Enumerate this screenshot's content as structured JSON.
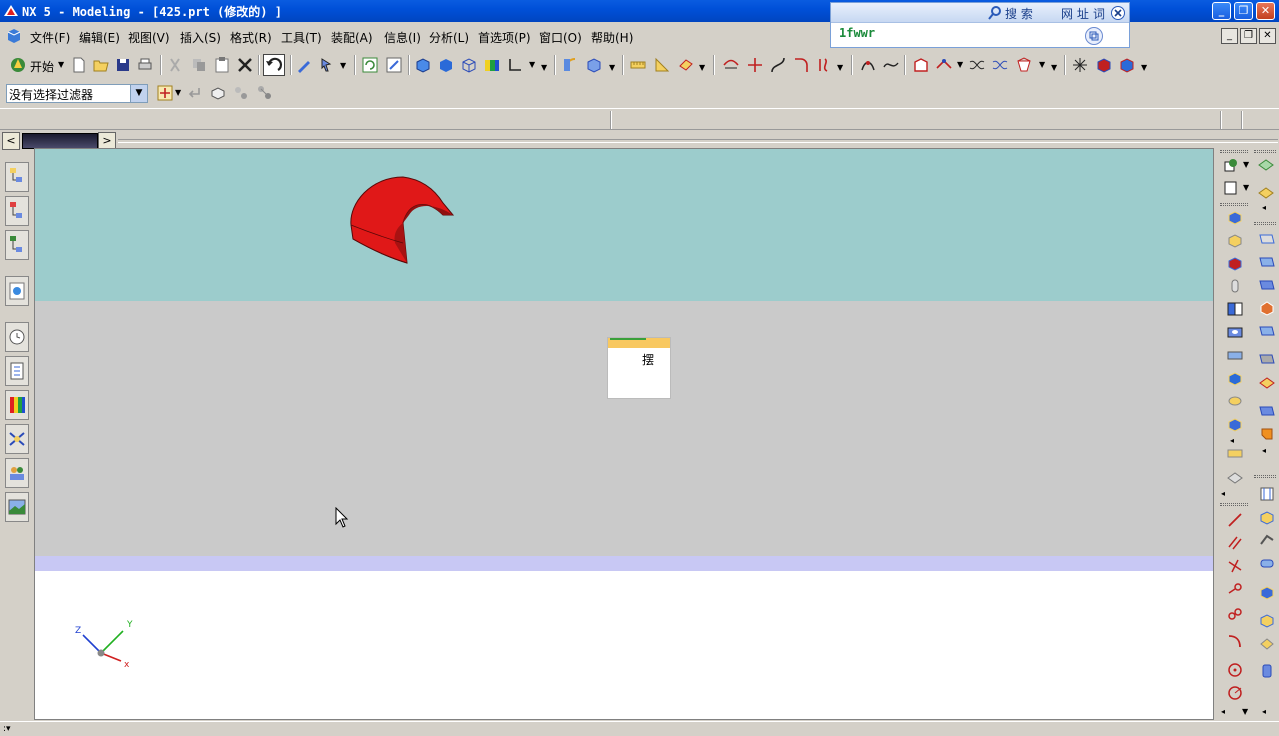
{
  "window": {
    "title": "NX 5 - Modeling - [425.prt  (修改的) ]",
    "minimize_label": "_",
    "maximize_label": "❐",
    "close_label": "✕"
  },
  "search_widget": {
    "tab_search": "搜 索",
    "tab_url": "网 址",
    "tab_dict": "词",
    "input_value": "1fwwr"
  },
  "menubar": {
    "items": [
      {
        "label": "文件(F)"
      },
      {
        "label": "编辑(E)"
      },
      {
        "label": "视图(V)"
      },
      {
        "label": "插入(S)"
      },
      {
        "label": "格式(R)"
      },
      {
        "label": "工具(T)"
      },
      {
        "label": "装配(A)"
      },
      {
        "label": "信息(I)"
      },
      {
        "label": "分析(L)"
      },
      {
        "label": "首选项(P)"
      },
      {
        "label": "窗口(O)"
      },
      {
        "label": "帮助(H)"
      }
    ]
  },
  "toolbar": {
    "start_label": "开始"
  },
  "selection_bar": {
    "filter_value": "没有选择过滤器"
  },
  "graphics": {
    "popup_text": "摆",
    "triad": {
      "x": "x",
      "y": "Y",
      "z": "Z"
    }
  },
  "colors": {
    "titlebar": "#0050d8",
    "background_top": "#9ccccc",
    "background_mid": "#cacaca",
    "background_band": "#c8c8f4",
    "part_red": "#e01818"
  }
}
